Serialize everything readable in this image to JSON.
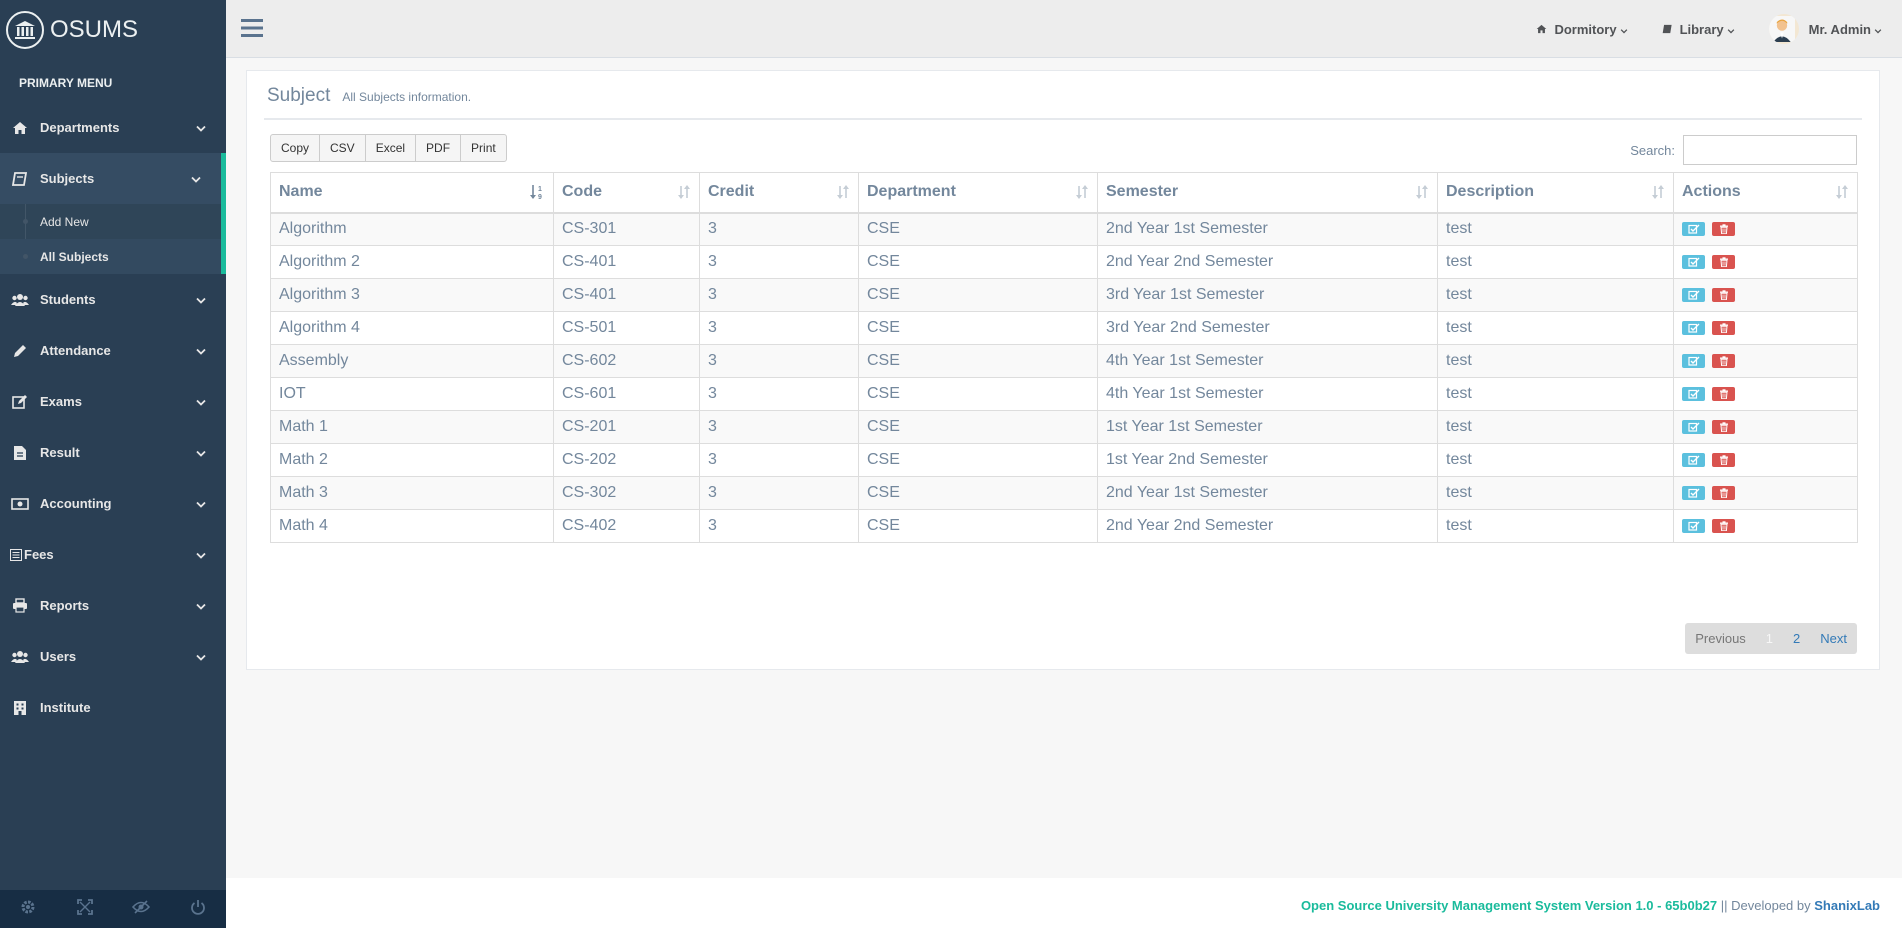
{
  "brand": {
    "name": "OSUMS"
  },
  "sidebar": {
    "heading": "PRIMARY MENU",
    "items": [
      {
        "label": "Departments",
        "icon": "home-icon"
      },
      {
        "label": "Subjects",
        "icon": "book-icon"
      },
      {
        "label": "Students",
        "icon": "users-icon"
      },
      {
        "label": "Attendance",
        "icon": "pencil-icon"
      },
      {
        "label": "Exams",
        "icon": "edit-icon"
      },
      {
        "label": "Result",
        "icon": "file-icon"
      },
      {
        "label": "Accounting",
        "icon": "money-icon"
      },
      {
        "label": "Fees",
        "icon": "list-icon"
      },
      {
        "label": "Reports",
        "icon": "printer-icon"
      },
      {
        "label": "Users",
        "icon": "users-icon"
      },
      {
        "label": "Institute",
        "icon": "building-icon"
      }
    ],
    "submenu": [
      {
        "label": "Add New"
      },
      {
        "label": "All Subjects"
      }
    ]
  },
  "topnav": {
    "dormitory": "Dormitory",
    "library": "Library",
    "user": "Mr. Admin"
  },
  "panel": {
    "title": "Subject",
    "subtitle": "All Subjects information."
  },
  "table": {
    "buttons": [
      "Copy",
      "CSV",
      "Excel",
      "PDF",
      "Print"
    ],
    "search_label": "Search:",
    "search_value": "",
    "columns": [
      "Name",
      "Code",
      "Credit",
      "Department",
      "Semester",
      "Description",
      "Actions"
    ],
    "rows": [
      [
        "Algorithm",
        "CS-301",
        "3",
        "CSE",
        "2nd Year 1st Semester",
        "test"
      ],
      [
        "Algorithm 2",
        "CS-401",
        "3",
        "CSE",
        "2nd Year 2nd Semester",
        "test"
      ],
      [
        "Algorithm 3",
        "CS-401",
        "3",
        "CSE",
        "3rd Year 1st Semester",
        "test"
      ],
      [
        "Algorithm 4",
        "CS-501",
        "3",
        "CSE",
        "3rd Year 2nd Semester",
        "test"
      ],
      [
        "Assembly",
        "CS-602",
        "3",
        "CSE",
        "4th Year 1st Semester",
        "test"
      ],
      [
        "IOT",
        "CS-601",
        "3",
        "CSE",
        "4th Year 1st Semester",
        "test"
      ],
      [
        "Math 1",
        "CS-201",
        "3",
        "CSE",
        "1st Year 1st Semester",
        "test"
      ],
      [
        "Math 2",
        "CS-202",
        "3",
        "CSE",
        "1st Year 2nd Semester",
        "test"
      ],
      [
        "Math 3",
        "CS-302",
        "3",
        "CSE",
        "2nd Year 1st Semester",
        "test"
      ],
      [
        "Math 4",
        "CS-402",
        "3",
        "CSE",
        "2nd Year 2nd Semester",
        "test"
      ]
    ]
  },
  "pagination": {
    "previous": "Previous",
    "pages": [
      "1",
      "2"
    ],
    "next": "Next"
  },
  "footer": {
    "system": "Open Source University Management System Version 1.0 - 65b0b27",
    "separator": "||",
    "developed_by": "Developed by",
    "developer": "ShanixLab"
  },
  "colors": {
    "sidebar": "#2a3f54",
    "accent": "#1abb9c",
    "edit": "#5bc0de",
    "delete": "#d9534f"
  }
}
